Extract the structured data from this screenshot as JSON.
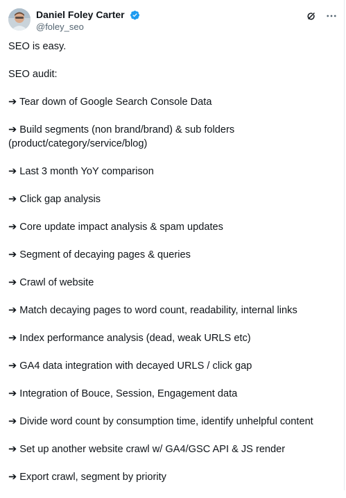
{
  "author": {
    "display_name": "Daniel Foley Carter",
    "handle": "@foley_seo",
    "verified": true
  },
  "icons": {
    "verified": "verified-badge-icon",
    "grok": "grok-icon",
    "more": "more-options-icon"
  },
  "colors": {
    "verified_blue": "#1d9bf0",
    "text_primary": "#0f1419",
    "text_secondary": "#536471"
  },
  "post": {
    "lines": [
      "SEO is easy.",
      "SEO audit:",
      "➔ Tear down of Google Search Console Data",
      "➔ Build segments (non brand/brand) & sub folders (product/category/service/blog)",
      "➔ Last 3 month YoY comparison",
      "➔ Click gap analysis",
      "➔ Core update impact analysis & spam updates",
      "➔ Segment of decaying pages & queries",
      "➔ Crawl of website",
      "➔ Match decaying pages to word count, readability, internal links",
      "➔ Index performance analysis (dead, weak URLS etc)",
      "➔ GA4 data integration with decayed URLS / click gap",
      "➔ Integration of Bouce, Session, Engagement data",
      "➔ Divide word count by consumption time, identify unhelpful content",
      "➔ Set up another website crawl w/ GA4/GSC API & JS render",
      "➔ Export crawl, segment by priority"
    ]
  }
}
